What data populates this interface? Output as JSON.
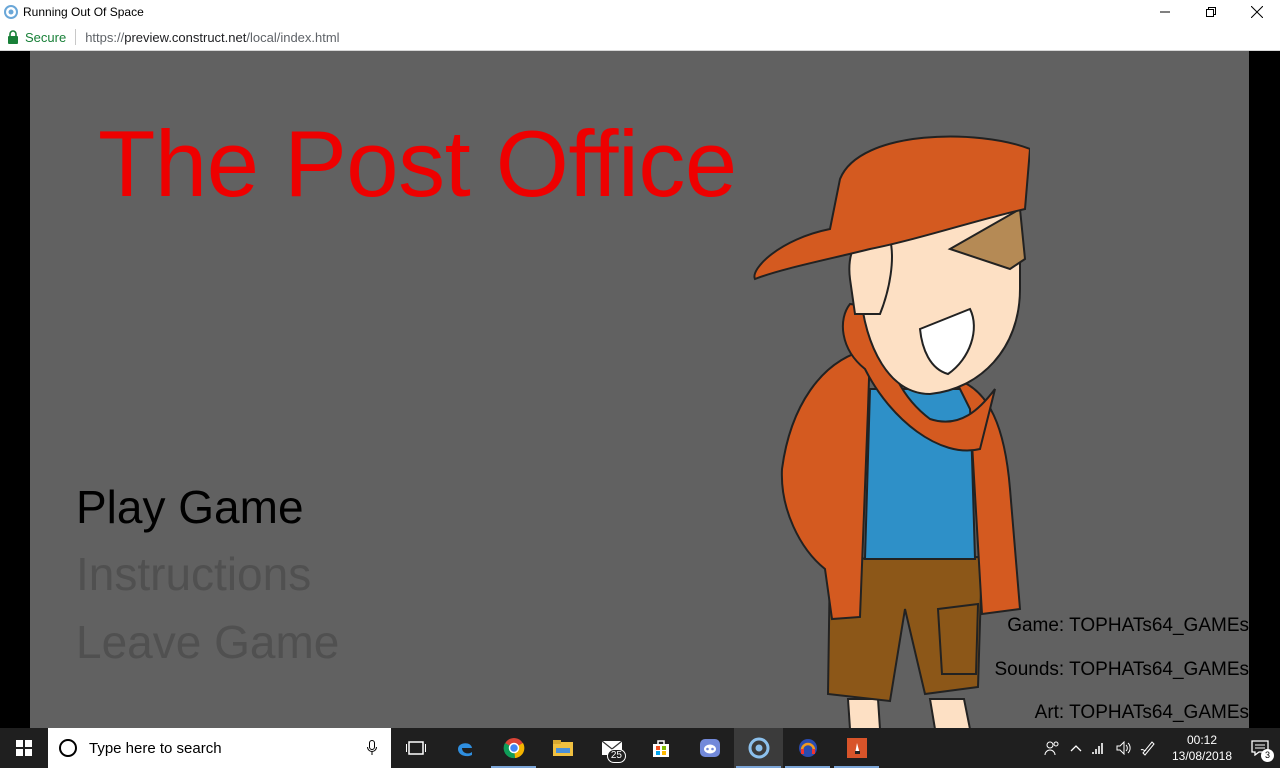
{
  "window": {
    "title": "Running Out Of Space"
  },
  "address_bar": {
    "secure_label": "Secure",
    "url_scheme": "https://",
    "url_host": "preview.construct.net",
    "url_path": "/local/index.html"
  },
  "game": {
    "title": "The Post Office",
    "menu": [
      {
        "label": "Play Game",
        "state": "selected"
      },
      {
        "label": "Instructions",
        "state": "normal"
      },
      {
        "label": "Leave Game",
        "state": "normal"
      }
    ],
    "credits": [
      "Game: TOPHATs64_GAMEs",
      "Sounds: TOPHATs64_GAMEs",
      "Art: TOPHATs64_GAMEs"
    ]
  },
  "taskbar": {
    "search_placeholder": "Type here to search",
    "mail_badge": "25",
    "clock_time": "00:12",
    "clock_date": "13/08/2018",
    "notification_count": "3"
  },
  "colors": {
    "title_red": "#ee0000",
    "game_bg": "#616161",
    "menu_selected": "#000000",
    "menu_normal": "#505050",
    "secure_green": "#188038"
  }
}
